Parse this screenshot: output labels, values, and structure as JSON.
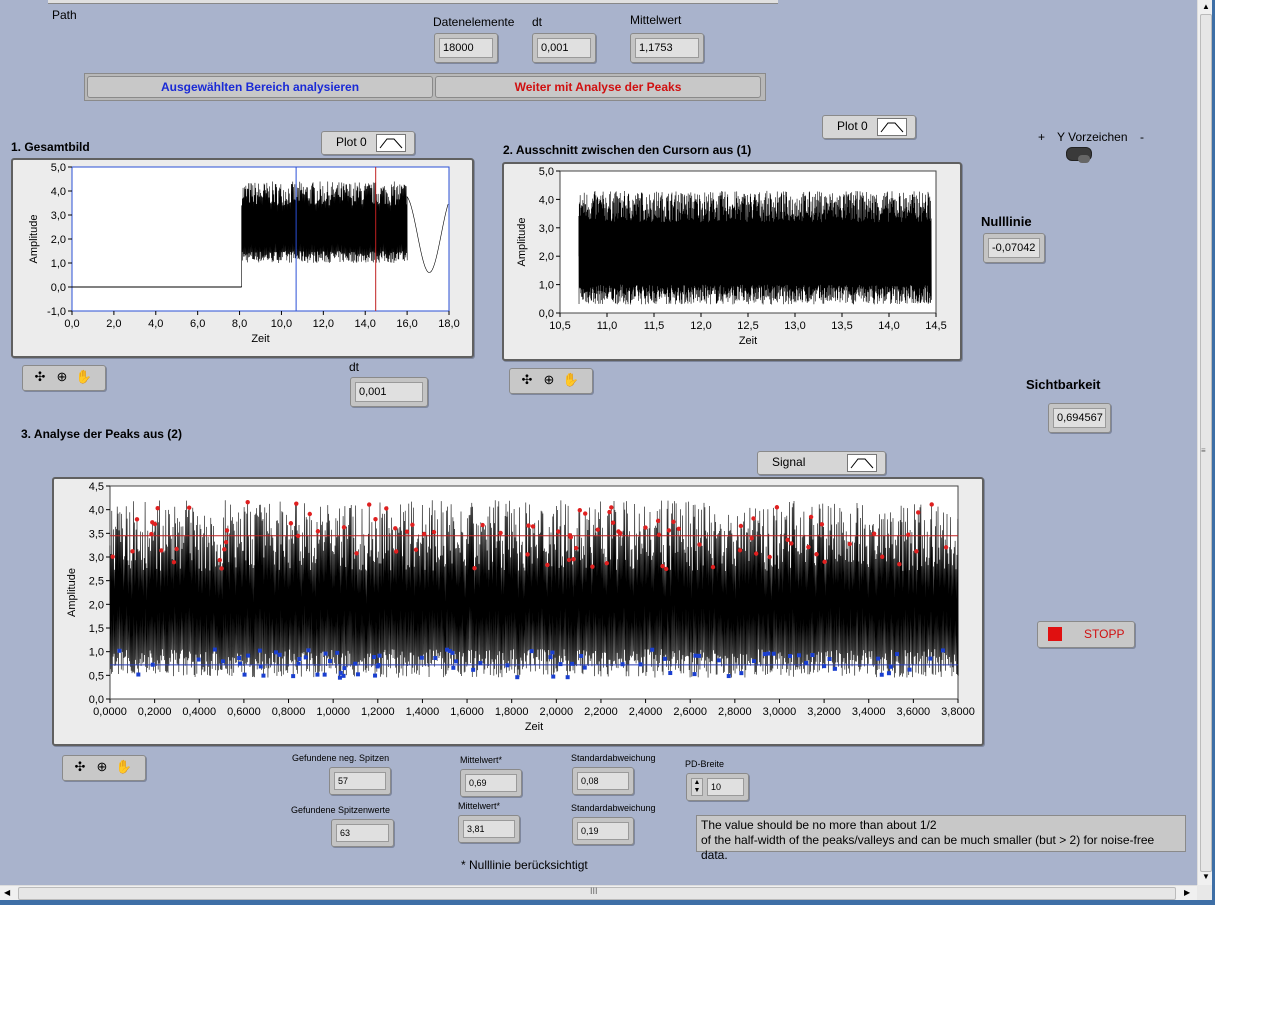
{
  "header": {
    "path_label": "Path",
    "datenelemente": {
      "label": "Datenelemente",
      "value": "18000"
    },
    "dt": {
      "label": "dt",
      "value": "0,001"
    },
    "mittelwert": {
      "label": "Mittelwert",
      "value": "1,1753"
    },
    "btn_analyse": "Ausgewählten Bereich analysieren",
    "btn_peaks": "Weiter mit Analyse der Peaks"
  },
  "graph1": {
    "title": "1. Gesamtbild",
    "legend": "Plot 0",
    "dt_label": "dt",
    "dt_value": "0,001",
    "chart_data": {
      "type": "line",
      "title": "1. Gesamtbild",
      "xlabel": "Zeit",
      "ylabel": "Amplitude",
      "xlim": [
        0,
        18
      ],
      "ylim": [
        -1,
        5
      ],
      "x_ticks": [
        "0,0",
        "2,0",
        "4,0",
        "6,0",
        "8,0",
        "10,0",
        "12,0",
        "14,0",
        "16,0",
        "18,0"
      ],
      "y_ticks": [
        "-1,0",
        "0,0",
        "1,0",
        "2,0",
        "3,0",
        "4,0",
        "5,0"
      ],
      "series": [
        {
          "segments": [
            {
              "x": [
                0,
                8.1
              ],
              "y": [
                0,
                0
              ]
            },
            {
              "x_range": [
                8.1,
                16.0
              ],
              "y_range": [
                1.0,
                4.4
              ]
            }
          ]
        }
      ],
      "cursors": [
        {
          "x": 10.7,
          "color": "#2a4fd6"
        },
        {
          "x": 14.5,
          "color": "#c02020"
        }
      ]
    }
  },
  "graph2": {
    "title": "2. Ausschnitt zwischen den Cursorn aus (1)",
    "legend": "Plot 0",
    "chart_data": {
      "type": "line",
      "title": "2. Ausschnitt zwischen den Cursorn aus (1)",
      "xlabel": "Zeit",
      "ylabel": "Amplitude",
      "xlim": [
        10.5,
        14.5
      ],
      "ylim": [
        0,
        5
      ],
      "x_ticks": [
        "10,5",
        "11,0",
        "11,5",
        "12,0",
        "12,5",
        "13,0",
        "13,5",
        "14,0",
        "14,5"
      ],
      "y_ticks": [
        "0,0",
        "1,0",
        "2,0",
        "3,0",
        "4,0",
        "5,0"
      ],
      "series": [
        {
          "x_range": [
            10.7,
            14.45
          ],
          "y_range": [
            0.5,
            4.3
          ]
        }
      ]
    }
  },
  "right": {
    "toggle_plus": "+",
    "toggle_label": "Y Vorzeichen",
    "toggle_minus": "-",
    "nulllinie_label": "Nulllinie",
    "nulllinie_value": "-0,07042",
    "sichtbarkeit_label": "Sichtbarkeit",
    "sichtbarkeit_value": "0,694567",
    "stopp": "STOPP"
  },
  "graph3": {
    "title": "3. Analyse der Peaks aus (2)",
    "legend": "Signal",
    "chart_data": {
      "type": "line",
      "title": "3. Analyse der Peaks aus (2)",
      "xlabel": "Zeit",
      "ylabel": "Amplitude",
      "xlim": [
        0,
        3.8
      ],
      "ylim": [
        0,
        4.5
      ],
      "x_ticks": [
        "0,0000",
        "0,2000",
        "0,4000",
        "0,6000",
        "0,8000",
        "1,0000",
        "1,2000",
        "1,4000",
        "1,6000",
        "1,8000",
        "2,0000",
        "2,2000",
        "2,4000",
        "2,6000",
        "2,8000",
        "3,0000",
        "3,2000",
        "3,4000",
        "3,6000",
        "3,8000"
      ],
      "y_ticks": [
        "0,0",
        "0,5",
        "1,0",
        "1,5",
        "2,0",
        "2,5",
        "3,0",
        "3,5",
        "4,0",
        "4,5"
      ],
      "series": [
        {
          "y_range": [
            0.5,
            4.2
          ]
        },
        {
          "mean_peaks": 3.45,
          "color": "#c02020"
        },
        {
          "mean_valleys": 0.72,
          "color": "#2a3fb8"
        }
      ]
    }
  },
  "stats": {
    "neg_spitzen_label": "Gefundene neg. Spitzen",
    "neg_spitzen_value": "57",
    "spitzenwerte_label": "Gefundene Spitzenwerte",
    "spitzenwerte_value": "63",
    "mittelwert1_label": "Mittelwert*",
    "mittelwert1_value": "0,69",
    "mittelwert2_label": "Mittelwert*",
    "mittelwert2_value": "3,81",
    "std1_label": "Standardabweichung",
    "std1_value": "0,08",
    "std2_label": "Standardabweichung",
    "std2_value": "0,19",
    "pd_label": "PD-Breite",
    "pd_value": "10",
    "note_line1": "The value should be no more than about 1/2",
    "note_line2": "of the half-width of the peaks/valleys and can be much smaller (but > 2) for noise-free data.",
    "footnote": "* Nulllinie berücksichtigt"
  },
  "scroll": {
    "grip": "III"
  }
}
